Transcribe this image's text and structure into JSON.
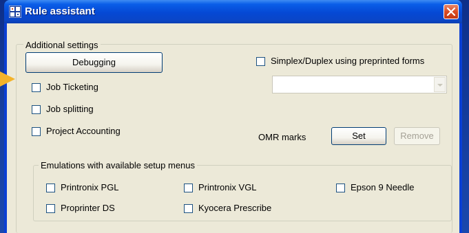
{
  "window": {
    "title": "Rule assistant",
    "accent_color": "#0a5ee8"
  },
  "additional_settings": {
    "group_title": "Additional settings",
    "debugging_button": "Debugging",
    "simplex_duplex_label": "Simplex/Duplex  using preprinted forms",
    "simplex_duplex_checked": false,
    "forms_dropdown_value": "",
    "job_ticketing_label": "Job Ticketing",
    "job_ticketing_checked": false,
    "job_splitting_label": "Job splitting",
    "job_splitting_checked": false,
    "project_accounting_label": "Project Accounting",
    "project_accounting_checked": false,
    "omr_marks_label": "OMR marks",
    "set_button": "Set",
    "remove_button": "Remove"
  },
  "emulations": {
    "group_title": "Emulations with available setup menus",
    "items": [
      {
        "label": "Printronix PGL",
        "checked": false
      },
      {
        "label": "Printronix VGL",
        "checked": false
      },
      {
        "label": "Epson 9 Needle",
        "checked": false
      },
      {
        "label": "Proprinter DS",
        "checked": false
      },
      {
        "label": "Kyocera Prescribe",
        "checked": false
      }
    ]
  },
  "icons": {
    "app": "rule-assistant-app-icon",
    "close": "close-icon",
    "pointer": "arrow-pointer-icon",
    "dropdown": "chevron-down-icon"
  }
}
